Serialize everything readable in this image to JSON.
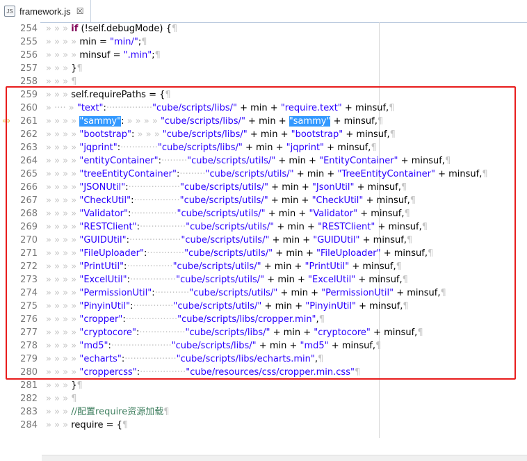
{
  "tab": {
    "title": "framework.js",
    "close": "☒",
    "icon": "js-file-icon"
  },
  "colors": {
    "keyword": "#7f0055",
    "string": "#2a00ff",
    "comment": "#3f7f5f",
    "highlight": "#3399ff",
    "box": "#e81c1c"
  },
  "lines": [
    {
      "n": "254",
      "t": [
        [
          "ws",
          "» » » "
        ],
        [
          "kw",
          "if"
        ],
        [
          "p",
          " (!self.debugMode) {"
        ],
        [
          "pil",
          "¶"
        ]
      ]
    },
    {
      "n": "255",
      "t": [
        [
          "ws",
          "» » » » "
        ],
        [
          "p",
          "min = "
        ],
        [
          "str",
          "\"min/\""
        ],
        [
          "p",
          ";"
        ],
        [
          "pil",
          "¶"
        ]
      ]
    },
    {
      "n": "256",
      "t": [
        [
          "ws",
          "» » » » "
        ],
        [
          "p",
          "minsuf = "
        ],
        [
          "str",
          "\".min\""
        ],
        [
          "p",
          ";"
        ],
        [
          "pil",
          "¶"
        ]
      ]
    },
    {
      "n": "257",
      "t": [
        [
          "ws",
          "» » » "
        ],
        [
          "p",
          "}"
        ],
        [
          "pil",
          "¶"
        ]
      ]
    },
    {
      "n": "258",
      "t": [
        [
          "ws",
          "» » » "
        ],
        [
          "pil",
          "¶"
        ]
      ]
    },
    {
      "n": "259",
      "t": [
        [
          "ws",
          "» » » "
        ],
        [
          "p",
          "self.requirePaths = {"
        ],
        [
          "pil",
          "¶"
        ]
      ]
    },
    {
      "n": "260",
      "t": [
        [
          "ws",
          "» ···· » "
        ],
        [
          "str",
          "\"text\""
        ],
        [
          "p",
          ":"
        ],
        [
          "ws",
          "················"
        ],
        [
          "str",
          "\"cube/scripts/libs/\""
        ],
        [
          "p",
          " + min + "
        ],
        [
          "str",
          "\"require.text\""
        ],
        [
          "p",
          " + minsuf,"
        ],
        [
          "pil",
          "¶"
        ]
      ]
    },
    {
      "n": "261",
      "arrow": true,
      "t": [
        [
          "ws",
          "» » » » "
        ],
        [
          "hl",
          "\"sammy\""
        ],
        [
          "p",
          ":"
        ],
        [
          "ws",
          " » » » » "
        ],
        [
          "str",
          "\"cube/scripts/libs/\""
        ],
        [
          "p",
          " + min + "
        ],
        [
          "hl",
          "\"sammy\""
        ],
        [
          "p",
          " + minsuf,"
        ],
        [
          "pil",
          "¶"
        ]
      ]
    },
    {
      "n": "262",
      "t": [
        [
          "ws",
          "» » » » "
        ],
        [
          "str",
          "\"bootstrap\""
        ],
        [
          "p",
          ":"
        ],
        [
          "ws",
          " » » » "
        ],
        [
          "str",
          "\"cube/scripts/libs/\""
        ],
        [
          "p",
          " + min + "
        ],
        [
          "str",
          "\"bootstrap\""
        ],
        [
          "p",
          " + minsuf,"
        ],
        [
          "pil",
          "¶"
        ]
      ]
    },
    {
      "n": "263",
      "t": [
        [
          "ws",
          "» » » » "
        ],
        [
          "str",
          "\"jqprint\""
        ],
        [
          "p",
          ":"
        ],
        [
          "ws",
          "·············"
        ],
        [
          "str",
          "\"cube/scripts/libs/\""
        ],
        [
          "p",
          " + min + "
        ],
        [
          "str",
          "\"jqprint\""
        ],
        [
          "p",
          " + minsuf,"
        ],
        [
          "pil",
          "¶"
        ]
      ]
    },
    {
      "n": "264",
      "t": [
        [
          "ws",
          "» » » » "
        ],
        [
          "str",
          "\"entityContainer\""
        ],
        [
          "p",
          ":"
        ],
        [
          "ws",
          "·········"
        ],
        [
          "str",
          "\"cube/scripts/utils/\""
        ],
        [
          "p",
          " + min + "
        ],
        [
          "str",
          "\"EntityContainer\""
        ],
        [
          "p",
          " + minsuf,"
        ],
        [
          "pil",
          "¶"
        ]
      ]
    },
    {
      "n": "265",
      "t": [
        [
          "ws",
          "» » » » "
        ],
        [
          "str",
          "\"treeEntityContainer\""
        ],
        [
          "p",
          ":"
        ],
        [
          "ws",
          "·········"
        ],
        [
          "str",
          "\"cube/scripts/utils/\""
        ],
        [
          "p",
          " + min + "
        ],
        [
          "str",
          "\"TreeEntityContainer\""
        ],
        [
          "p",
          " + minsuf,"
        ],
        [
          "pil",
          "¶"
        ]
      ]
    },
    {
      "n": "266",
      "t": [
        [
          "ws",
          "» » » » "
        ],
        [
          "str",
          "\"JSONUtil\""
        ],
        [
          "p",
          ":"
        ],
        [
          "ws",
          "··················"
        ],
        [
          "str",
          "\"cube/scripts/utils/\""
        ],
        [
          "p",
          " + min + "
        ],
        [
          "str",
          "\"JsonUtil\""
        ],
        [
          "p",
          " + minsuf,"
        ],
        [
          "pil",
          "¶"
        ]
      ]
    },
    {
      "n": "267",
      "t": [
        [
          "ws",
          "» » » » "
        ],
        [
          "str",
          "\"CheckUtil\""
        ],
        [
          "p",
          ":"
        ],
        [
          "ws",
          "················"
        ],
        [
          "str",
          "\"cube/scripts/utils/\""
        ],
        [
          "p",
          " + min + "
        ],
        [
          "str",
          "\"CheckUtil\""
        ],
        [
          "p",
          " + minsuf,"
        ],
        [
          "pil",
          "¶"
        ]
      ]
    },
    {
      "n": "268",
      "t": [
        [
          "ws",
          "» » » » "
        ],
        [
          "str",
          "\"Validator\""
        ],
        [
          "p",
          ":"
        ],
        [
          "ws",
          "················"
        ],
        [
          "str",
          "\"cube/scripts/utils/\""
        ],
        [
          "p",
          " + min + "
        ],
        [
          "str",
          "\"Validator\""
        ],
        [
          "p",
          " + minsuf,"
        ],
        [
          "pil",
          "¶"
        ]
      ]
    },
    {
      "n": "269",
      "t": [
        [
          "ws",
          "» » » » "
        ],
        [
          "str",
          "\"RESTClient\""
        ],
        [
          "p",
          ":"
        ],
        [
          "ws",
          "················"
        ],
        [
          "str",
          "\"cube/scripts/utils/\""
        ],
        [
          "p",
          " + min + "
        ],
        [
          "str",
          "\"RESTClient\""
        ],
        [
          "p",
          " + minsuf,"
        ],
        [
          "pil",
          "¶"
        ]
      ]
    },
    {
      "n": "270",
      "t": [
        [
          "ws",
          "» » » » "
        ],
        [
          "str",
          "\"GUIDUtil\""
        ],
        [
          "p",
          ":"
        ],
        [
          "ws",
          "··················"
        ],
        [
          "str",
          "\"cube/scripts/utils/\""
        ],
        [
          "p",
          " + min + "
        ],
        [
          "str",
          "\"GUIDUtil\""
        ],
        [
          "p",
          " + minsuf,"
        ],
        [
          "pil",
          "¶"
        ]
      ]
    },
    {
      "n": "271",
      "t": [
        [
          "ws",
          "» » » » "
        ],
        [
          "str",
          "\"FileUploader\""
        ],
        [
          "p",
          ":"
        ],
        [
          "ws",
          "·············"
        ],
        [
          "str",
          "\"cube/scripts/utils/\""
        ],
        [
          "p",
          " + min + "
        ],
        [
          "str",
          "\"FileUploader\""
        ],
        [
          "p",
          " + minsuf,"
        ],
        [
          "pil",
          "¶"
        ]
      ]
    },
    {
      "n": "272",
      "t": [
        [
          "ws",
          "» » » » "
        ],
        [
          "str",
          "\"PrintUtil\""
        ],
        [
          "p",
          ":"
        ],
        [
          "ws",
          "················"
        ],
        [
          "str",
          "\"cube/scripts/utils/\""
        ],
        [
          "p",
          " + min + "
        ],
        [
          "str",
          "\"PrintUtil\""
        ],
        [
          "p",
          " + minsuf,"
        ],
        [
          "pil",
          "¶"
        ]
      ]
    },
    {
      "n": "273",
      "t": [
        [
          "ws",
          "» » » » "
        ],
        [
          "str",
          "\"ExcelUtil\""
        ],
        [
          "p",
          ":"
        ],
        [
          "ws",
          "················"
        ],
        [
          "str",
          "\"cube/scripts/utils/\""
        ],
        [
          "p",
          " + min + "
        ],
        [
          "str",
          "\"ExcelUtil\""
        ],
        [
          "p",
          " + minsuf,"
        ],
        [
          "pil",
          "¶"
        ]
      ]
    },
    {
      "n": "274",
      "t": [
        [
          "ws",
          "» » » » "
        ],
        [
          "str",
          "\"PermissionUtil\""
        ],
        [
          "p",
          ":"
        ],
        [
          "ws",
          "············"
        ],
        [
          "str",
          "\"cube/scripts/utils/\""
        ],
        [
          "p",
          " + min + "
        ],
        [
          "str",
          "\"PermissionUtil\""
        ],
        [
          "p",
          " + minsuf,"
        ],
        [
          "pil",
          "¶"
        ]
      ]
    },
    {
      "n": "275",
      "t": [
        [
          "ws",
          "» » » » "
        ],
        [
          "str",
          "\"PinyinUtil\""
        ],
        [
          "p",
          ":"
        ],
        [
          "ws",
          "··············"
        ],
        [
          "str",
          "\"cube/scripts/utils/\""
        ],
        [
          "p",
          " + min + "
        ],
        [
          "str",
          "\"PinyinUtil\""
        ],
        [
          "p",
          " + minsuf,"
        ],
        [
          "pil",
          "¶"
        ]
      ]
    },
    {
      "n": "276",
      "t": [
        [
          "ws",
          "» » » » "
        ],
        [
          "str",
          "\"cropper\""
        ],
        [
          "p",
          ":"
        ],
        [
          "ws",
          "··················"
        ],
        [
          "str",
          "\"cube/scripts/libs/cropper.min\""
        ],
        [
          "p",
          ","
        ],
        [
          "pil",
          "¶"
        ]
      ]
    },
    {
      "n": "277",
      "t": [
        [
          "ws",
          "» » » » "
        ],
        [
          "str",
          "\"cryptocore\""
        ],
        [
          "p",
          ":"
        ],
        [
          "ws",
          "················"
        ],
        [
          "str",
          "\"cube/scripts/libs/\""
        ],
        [
          "p",
          " + min + "
        ],
        [
          "str",
          "\"cryptocore\""
        ],
        [
          "p",
          " + minsuf,"
        ],
        [
          "pil",
          "¶"
        ]
      ]
    },
    {
      "n": "278",
      "t": [
        [
          "ws",
          "» » » » "
        ],
        [
          "str",
          "\"md5\""
        ],
        [
          "p",
          ":"
        ],
        [
          "ws",
          "·····················"
        ],
        [
          "str",
          "\"cube/scripts/libs/\""
        ],
        [
          "p",
          " + min + "
        ],
        [
          "str",
          "\"md5\""
        ],
        [
          "p",
          " + minsuf,"
        ],
        [
          "pil",
          "¶"
        ]
      ]
    },
    {
      "n": "279",
      "t": [
        [
          "ws",
          "» » » » "
        ],
        [
          "str",
          "\"echarts\""
        ],
        [
          "p",
          ":"
        ],
        [
          "ws",
          "··················"
        ],
        [
          "str",
          "\"cube/scripts/libs/echarts.min\""
        ],
        [
          "p",
          ","
        ],
        [
          "pil",
          "¶"
        ]
      ]
    },
    {
      "n": "280",
      "t": [
        [
          "ws",
          "» » » » "
        ],
        [
          "str",
          "\"croppercss\""
        ],
        [
          "p",
          ":"
        ],
        [
          "ws",
          "················"
        ],
        [
          "str",
          "\"cube/resources/css/cropper.min.css\""
        ],
        [
          "pil",
          "¶"
        ]
      ]
    },
    {
      "n": "281",
      "t": [
        [
          "ws",
          "» » » "
        ],
        [
          "p",
          "}"
        ],
        [
          "pil",
          "¶"
        ]
      ]
    },
    {
      "n": "282",
      "t": [
        [
          "ws",
          "» » » "
        ],
        [
          "pil",
          "¶"
        ]
      ]
    },
    {
      "n": "283",
      "t": [
        [
          "ws",
          "» » » "
        ],
        [
          "cmt",
          "//配置require资源加载"
        ],
        [
          "pil",
          "¶"
        ]
      ]
    },
    {
      "n": "284",
      "t": [
        [
          "ws",
          "» » » "
        ],
        [
          "p",
          "require = {"
        ],
        [
          "pil",
          "¶"
        ]
      ]
    }
  ]
}
